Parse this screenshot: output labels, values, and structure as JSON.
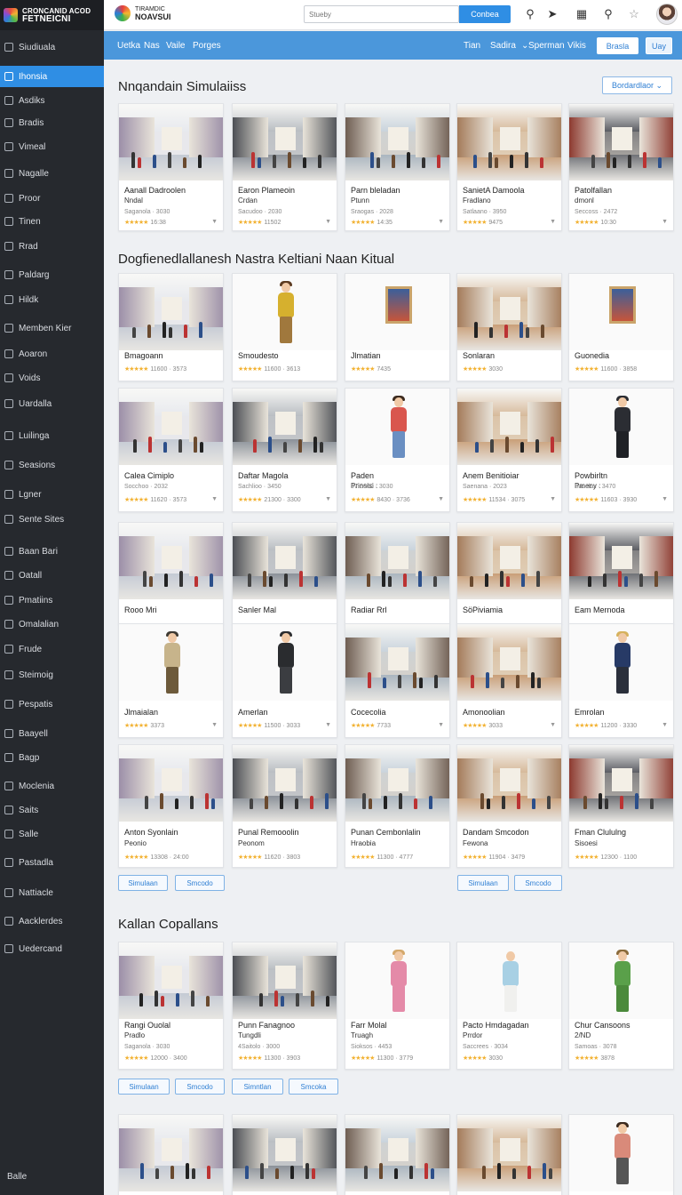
{
  "app": {
    "sidebar_logo_line1": "CRONCANID ACOD",
    "sidebar_logo_line2": "FETNEICNI",
    "brand_top": "TIRAMDIC",
    "brand_bottom": "NOAVSUI"
  },
  "topbar": {
    "search_placeholder": "Stueby",
    "search_button": "Conbea"
  },
  "sidebar": {
    "items": [
      {
        "label": "Siudiuala"
      },
      {
        "label": "Ihonsia"
      },
      {
        "label": "Asdiks"
      },
      {
        "label": "Bradis"
      },
      {
        "label": "Vimeal"
      },
      {
        "label": "Nagalle"
      },
      {
        "label": "Proor"
      },
      {
        "label": "Tinen"
      },
      {
        "label": "Rrad"
      },
      {
        "label": "Paldarg"
      },
      {
        "label": "Hildk"
      },
      {
        "label": "Memben Kier"
      },
      {
        "label": "Aoaron"
      },
      {
        "label": "Voids"
      },
      {
        "label": "Uardalla"
      },
      {
        "label": "Luilinga"
      },
      {
        "label": "Seasions"
      },
      {
        "label": "Lgner"
      },
      {
        "label": "Sente Sites"
      },
      {
        "label": "Baan Bari"
      },
      {
        "label": "Oatall"
      },
      {
        "label": "Pmatiins"
      },
      {
        "label": "Omalalian"
      },
      {
        "label": "Frude"
      },
      {
        "label": "Steimoig"
      },
      {
        "label": "Pespatis"
      },
      {
        "label": "Baayell"
      },
      {
        "label": "Bagp"
      },
      {
        "label": "Moclenia"
      },
      {
        "label": "Saits"
      },
      {
        "label": "Salle"
      },
      {
        "label": "Pastadla"
      },
      {
        "label": "Nattiacle"
      },
      {
        "label": "Aacklerdes"
      },
      {
        "label": "Uedercand"
      }
    ],
    "bottom": "Balle"
  },
  "nav": {
    "left": [
      "Uetka",
      "Nas",
      "Vaile",
      "Porges"
    ],
    "right": [
      "Tian",
      "Sadira",
      "Sperman",
      "Vikis"
    ],
    "primary_button": "Brasla",
    "secondary_button": "Uay"
  },
  "sections": {
    "s1_title": "Nnqandain Simulaiiss",
    "s1_dropdown": "Bordardlaor",
    "s2_title": "Dogfienedlallanesh Nastra Keltiani Naan Kitual",
    "s3_title": "Kallan Copallans"
  },
  "cards": {
    "r1": [
      {
        "t1": "Aanall Dadroolen",
        "t2": "Nndal",
        "meta": "Saganola · 3030",
        "rate": "16:38"
      },
      {
        "t1": "Earon Plameoin",
        "t2": "Crdan",
        "meta": "Sacudoo · 2030",
        "rate": "11502"
      },
      {
        "t1": "Parn bleladan",
        "t2": "Ptunn",
        "meta": "Sraogas · 2028",
        "rate": "14:35"
      },
      {
        "t1": "SanietA Damoola",
        "t2": "Fradlano",
        "meta": "Satlaano · 3950",
        "rate": "9475"
      },
      {
        "t1": "Patolfallan",
        "t2": "dmonl",
        "meta": "Seccoss · 2472",
        "rate": "10:30"
      }
    ],
    "r2": [
      {
        "t1": "Bmagoann",
        "rate": "11600 · 3573"
      },
      {
        "t1": "Smoudesto",
        "rate": "11600 · 3613"
      },
      {
        "t1": "Jlmatian",
        "rate": "7435"
      },
      {
        "t1": "Sonlaran",
        "rate": "3030"
      },
      {
        "t1": "Guonedia",
        "rate": "11600 · 3858"
      }
    ],
    "r3": [
      {
        "t1": "Calea Cimiplo",
        "meta": "Socchoo · 2032",
        "rate": "11620 · 3573"
      },
      {
        "t1": "Daftar Magola",
        "meta": "Sachlioo · 3450",
        "rate": "21300 · 3300"
      },
      {
        "t1": "Paden",
        "t2": "Prinsisi :",
        "meta": "37·3000 · 3030",
        "rate": "8430 · 3736"
      },
      {
        "t1": "Anem Benitioiar",
        "meta": "Saenana · 2023",
        "rate": "11534 · 3075"
      },
      {
        "t1": "Powbirltn",
        "t2": "Pmeny :",
        "meta": "Sacclos · 3470",
        "rate": "11603 · 3930"
      }
    ],
    "r4": [
      {
        "t1": "Rooo Mri"
      },
      {
        "t1": "Sanler Mal"
      },
      {
        "t1": "Radiar Rrl"
      },
      {
        "t1": "SöPiviamia"
      },
      {
        "t1": "Eam Mernoda"
      }
    ],
    "r5": [
      {
        "t1": "Jlmaialan",
        "rate": "3373"
      },
      {
        "t1": "Amerlan",
        "rate": "11500 · 3033"
      },
      {
        "t1": "Cocecolia",
        "rate": "7733"
      },
      {
        "t1": "Amonoolian",
        "rate": "3033"
      },
      {
        "t1": "Emrolan",
        "rate": "11200 · 3330"
      }
    ],
    "r6": [
      {
        "t1": "Anton Syonlain",
        "t2": "Peonio",
        "rate": "13308 · 24:00"
      },
      {
        "t1": "Punal Remooolin",
        "t2": "Peonom",
        "rate": "11620 · 3803"
      },
      {
        "t1": "Punan Cembonlalin",
        "t2": "Hraobia",
        "rate": "11300 · 4777"
      },
      {
        "t1": "Dandam Smcodon",
        "t2": "Fewona",
        "rate": "11904 · 3479"
      },
      {
        "t1": "Fman Clululng",
        "t2": "Sisoesi",
        "rate": "12300 · 1100"
      }
    ],
    "pills_a": [
      "Simulaan",
      "Smcodo"
    ],
    "pills_b": [
      "Simulaan",
      "Smcodo"
    ],
    "r7": [
      {
        "t1": "Rangi Ouolal",
        "t2": "Pradlo",
        "meta": "Saganola · 3030",
        "rate": "12000 · 3400"
      },
      {
        "t1": "Punn Fanagnoo",
        "t2": "Tungdli",
        "meta": "4Saitolo · 3000",
        "rate": "11300 · 3903"
      },
      {
        "t1": "Farr Molal",
        "t2": "Truagh",
        "meta": "Sioksos · 4453",
        "rate": "11300 · 3779"
      },
      {
        "t1": "Pacto Hmdagadan",
        "t2": "Prrdor",
        "meta": "Saccrees · 3034",
        "rate": "3030"
      },
      {
        "t1": "Chur Cansoons",
        "t2": "2/ND",
        "meta": "Samoas · 3078",
        "rate": "3878"
      }
    ],
    "pills_c": [
      "Simulaan",
      "Smcodo",
      "Simntlan",
      "Smcoka"
    ]
  },
  "colors": {
    "accent": "#2f8ee4",
    "nav": "#4b97db",
    "sidebar": "#26292e",
    "star": "#f2b233"
  }
}
